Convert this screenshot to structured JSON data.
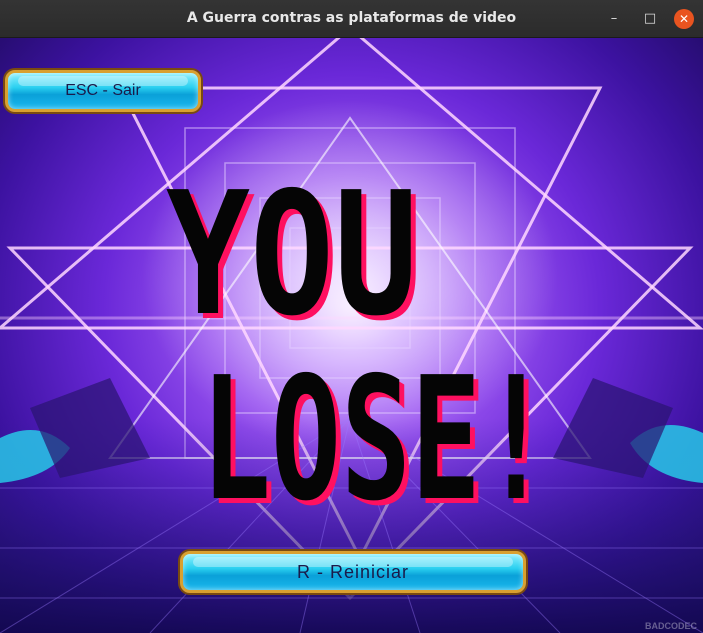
{
  "window": {
    "title": "A Guerra contras as plataformas de video",
    "minimize_glyph": "–",
    "maximize_glyph": "□",
    "close_glyph": "✕"
  },
  "game": {
    "message_line1": "YOU",
    "message_line2": "LOSE!",
    "esc_button_label": "ESC - Sair",
    "restart_button_label": "R - Reiniciar",
    "watermark": "BADCODEC"
  },
  "colors": {
    "text_fill": "#050505",
    "text_shadow": "#ff1060",
    "button_border": "#d9a030",
    "button_fill": "#1ab8ee",
    "close_button": "#e95420"
  }
}
